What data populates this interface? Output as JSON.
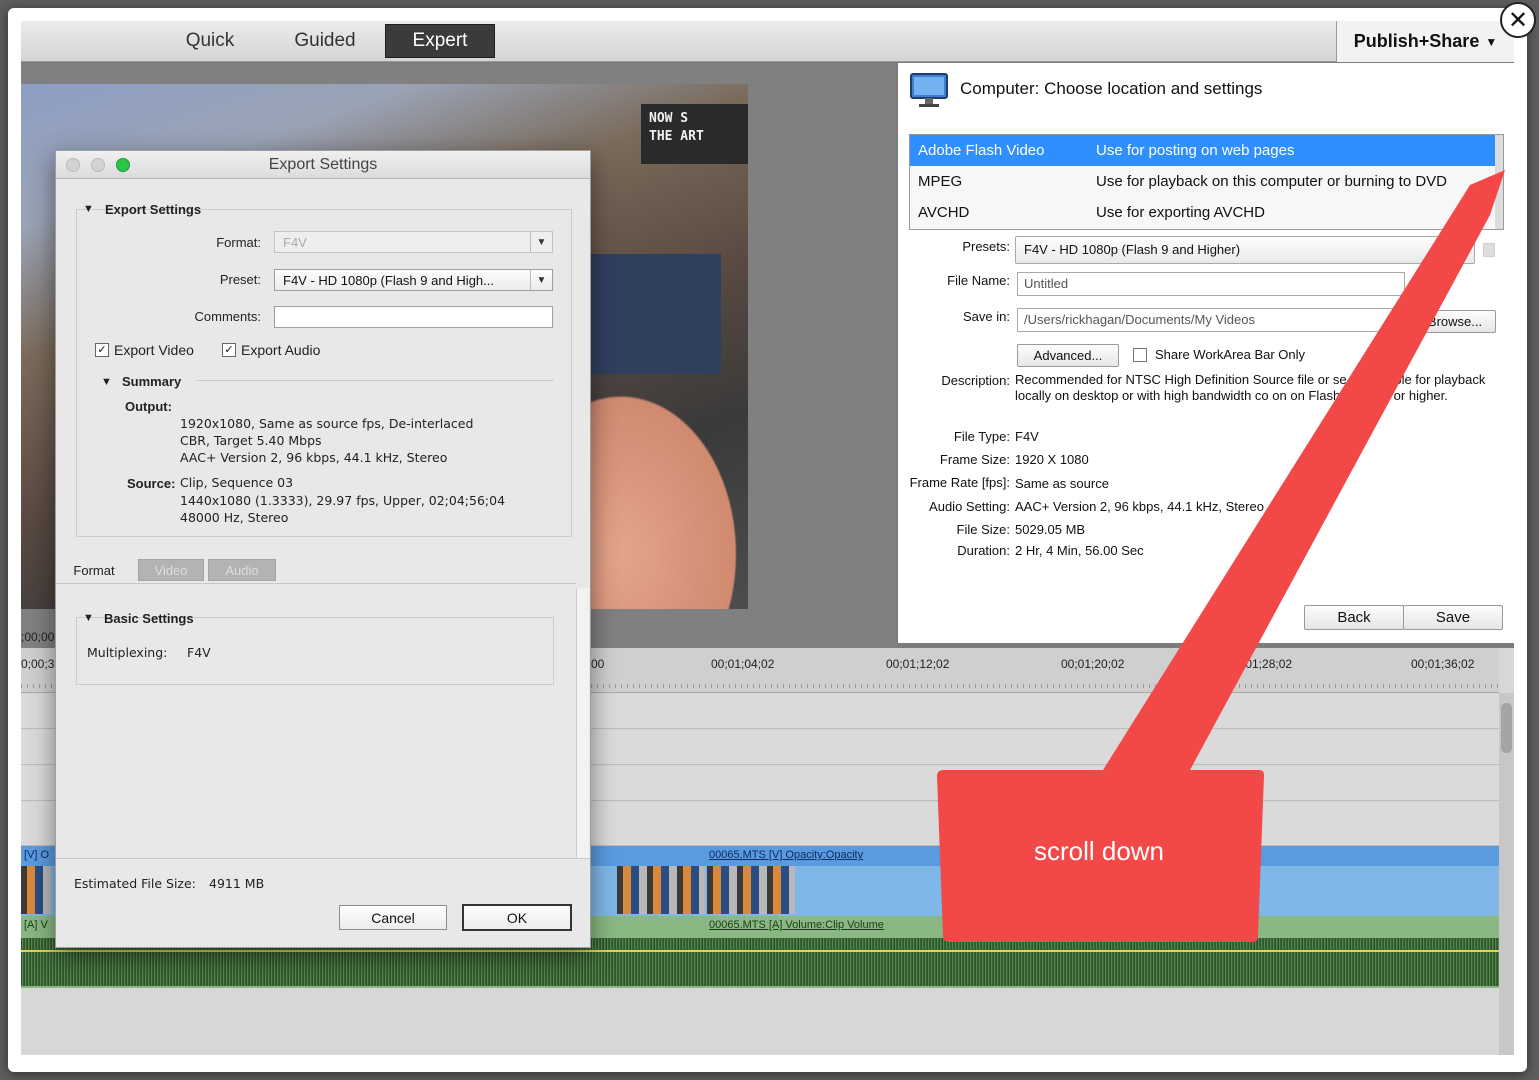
{
  "modes": {
    "quick": "Quick",
    "guided": "Guided",
    "expert": "Expert",
    "publish_share": "Publish+Share"
  },
  "preview": {
    "sign_line1": "NOW S",
    "sign_line2": "THE ART",
    "timecode_left": ";00;00",
    "timecode_left2": "0;00;3"
  },
  "publish_panel": {
    "heading": "Computer: Choose location and settings",
    "formats": [
      {
        "name": "Adobe Flash Video",
        "desc": "Use for posting on web pages"
      },
      {
        "name": "MPEG",
        "desc": "Use for playback on this computer or burning to DVD"
      },
      {
        "name": "AVCHD",
        "desc": "Use for exporting AVCHD"
      }
    ],
    "presets_label": "Presets:",
    "presets_value": "F4V - HD 1080p  (Flash 9 and Higher)",
    "file_name_label": "File Name:",
    "file_name_value": "Untitled",
    "save_in_label": "Save in:",
    "save_in_value": "/Users/rickhagan/Documents/My Videos",
    "browse_button": "Browse...",
    "advanced_button": "Advanced...",
    "share_workarea_label": "Share WorkArea Bar Only",
    "description_label": "Description:",
    "description_value": "Recommended for NTSC High Definition Source file or se      e. Suitable for playback locally on desktop or with high bandwidth co          on on Flash 9 player or higher.",
    "file_type_label": "File Type:",
    "file_type_value": "F4V",
    "frame_size_label": "Frame Size:",
    "frame_size_value": "1920 X 1080",
    "frame_rate_label": "Frame Rate [fps]:",
    "frame_rate_value": "Same as source",
    "audio_setting_label": "Audio Setting:",
    "audio_setting_value": "AAC+ Version 2, 96 kbps, 44.1 kHz, Stereo",
    "file_size_label": "File Size:",
    "file_size_value": "5029.05 MB",
    "duration_label": "Duration:",
    "duration_value": "2 Hr, 4 Min, 56.00 Sec",
    "back_button": "Back",
    "save_button": "Save"
  },
  "timeline": {
    "ticks": [
      "0;00;3",
      "00",
      "00;01;04;02",
      "00;01;12;02",
      "00;01;20;02",
      ";01;28;02",
      "00;01;36;02"
    ],
    "video_clip_left": "[V] O",
    "video_clip_label": "00065.MTS [V] Opacity:Opacity",
    "audio_clip_left": "[A] V",
    "audio_clip_label": "00065.MTS [A] Volume:Clip Volume"
  },
  "export_dialog": {
    "title": "Export Settings",
    "section_export": "Export Settings",
    "format_label": "Format:",
    "format_value": "F4V",
    "preset_label": "Preset:",
    "preset_value": "F4V - HD 1080p  (Flash 9 and High...",
    "comments_label": "Comments:",
    "export_video_label": "Export Video",
    "export_audio_label": "Export Audio",
    "summary_head": "Summary",
    "output_label": "Output:",
    "output_line1": "1920x1080, Same as source fps, De-interlaced",
    "output_line2": "CBR, Target 5.40 Mbps",
    "output_line3": "AAC+ Version 2, 96 kbps, 44.1 kHz, Stereo",
    "source_label": "Source:",
    "source_line1": "Clip, Sequence 03",
    "source_line2": "1440x1080 (1.3333), 29.97 fps, Upper, 02;04;56;04",
    "source_line3": "48000 Hz, Stereo",
    "tab_format": "Format",
    "tab_video": "Video",
    "tab_audio": "Audio",
    "basic_settings_head": "Basic Settings",
    "multiplexing_label": "Multiplexing:",
    "multiplexing_value": "F4V",
    "estimated_size_label": "Estimated File Size:",
    "estimated_size_value": "4911 MB",
    "cancel_button": "Cancel",
    "ok_button": "OK"
  },
  "annotation": {
    "text": "scroll down",
    "color": "#f24848"
  },
  "colors": {
    "selection_blue": "#2f8fff",
    "video_track": "#7fb7e8",
    "audio_track": "#89b883"
  }
}
